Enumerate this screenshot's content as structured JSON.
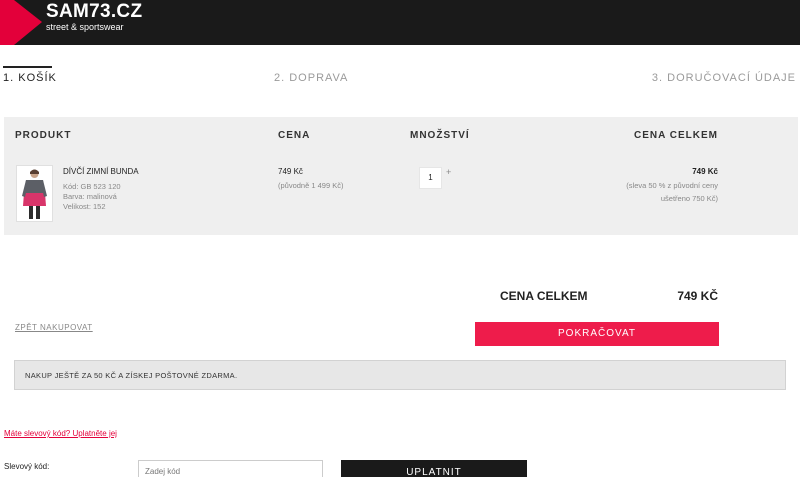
{
  "header": {
    "logo_name": "SAM73.CZ",
    "logo_tagline": "street & sportswear",
    "bg_color": "#1a1a1a",
    "accent_color": "#e3003a"
  },
  "steps": [
    {
      "label": "1. KOŠÍK",
      "active": true
    },
    {
      "label": "2. DOPRAVA",
      "active": false
    },
    {
      "label": "3. DORUČOVACÍ ÚDAJE",
      "active": false
    }
  ],
  "cart": {
    "columns": {
      "product": "PRODUKT",
      "price": "CENA",
      "quantity": "MNOŽSTVÍ",
      "total": "CENA CELKEM"
    },
    "items": [
      {
        "name": "DÍVČÍ ZIMNÍ BUNDA",
        "code": "Kód: GB 523 120",
        "color": "Barva: malinová",
        "size": "Velikost: 152",
        "price": "749 Kč",
        "original_price": "(původně 1 499 Kč)",
        "quantity": "1",
        "plus": "+",
        "total": "749 Kč",
        "discount_note_1": "(sleva 50 % z původní ceny",
        "discount_note_2": "ušetřeno 750 Kč)"
      }
    ]
  },
  "summary": {
    "label": "CENA CELKEM",
    "value": "749 KČ"
  },
  "actions": {
    "back": "ZPĚT NAKUPOVAT",
    "continue": "POKRAČOVAT",
    "continue_color": "#ee1c4b"
  },
  "notice": "NAKUP JEŠTĚ ZA 50 KČ A ZÍSKEJ POŠTOVNÉ ZDARMA.",
  "coupon": {
    "link": "Máte slevový kód? Uplatněte jej",
    "label": "Slevový kód:",
    "placeholder": "Zadej kód",
    "apply": "UPLATNIT"
  }
}
